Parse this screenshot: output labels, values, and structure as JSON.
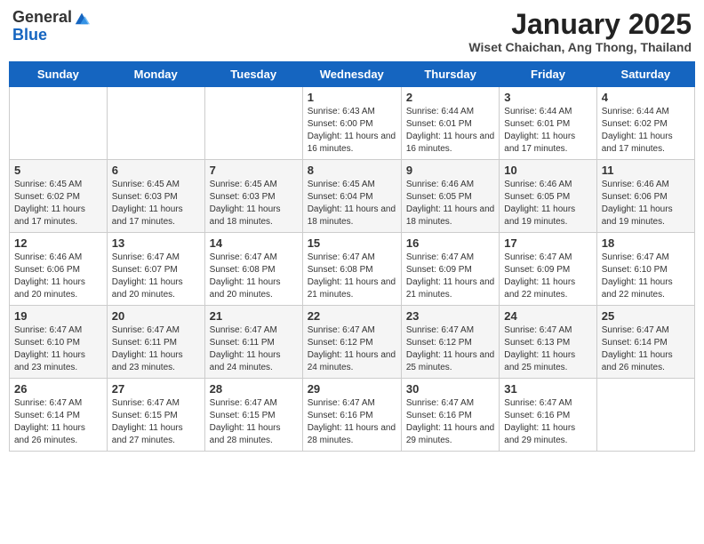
{
  "logo": {
    "general": "General",
    "blue": "Blue"
  },
  "title": "January 2025",
  "subtitle": "Wiset Chaichan, Ang Thong, Thailand",
  "days": [
    "Sunday",
    "Monday",
    "Tuesday",
    "Wednesday",
    "Thursday",
    "Friday",
    "Saturday"
  ],
  "weeks": [
    [
      {
        "day": "",
        "sunrise": "",
        "sunset": "",
        "daylight": ""
      },
      {
        "day": "",
        "sunrise": "",
        "sunset": "",
        "daylight": ""
      },
      {
        "day": "",
        "sunrise": "",
        "sunset": "",
        "daylight": ""
      },
      {
        "day": "1",
        "sunrise": "Sunrise: 6:43 AM",
        "sunset": "Sunset: 6:00 PM",
        "daylight": "Daylight: 11 hours and 16 minutes."
      },
      {
        "day": "2",
        "sunrise": "Sunrise: 6:44 AM",
        "sunset": "Sunset: 6:01 PM",
        "daylight": "Daylight: 11 hours and 16 minutes."
      },
      {
        "day": "3",
        "sunrise": "Sunrise: 6:44 AM",
        "sunset": "Sunset: 6:01 PM",
        "daylight": "Daylight: 11 hours and 17 minutes."
      },
      {
        "day": "4",
        "sunrise": "Sunrise: 6:44 AM",
        "sunset": "Sunset: 6:02 PM",
        "daylight": "Daylight: 11 hours and 17 minutes."
      }
    ],
    [
      {
        "day": "5",
        "sunrise": "Sunrise: 6:45 AM",
        "sunset": "Sunset: 6:02 PM",
        "daylight": "Daylight: 11 hours and 17 minutes."
      },
      {
        "day": "6",
        "sunrise": "Sunrise: 6:45 AM",
        "sunset": "Sunset: 6:03 PM",
        "daylight": "Daylight: 11 hours and 17 minutes."
      },
      {
        "day": "7",
        "sunrise": "Sunrise: 6:45 AM",
        "sunset": "Sunset: 6:03 PM",
        "daylight": "Daylight: 11 hours and 18 minutes."
      },
      {
        "day": "8",
        "sunrise": "Sunrise: 6:45 AM",
        "sunset": "Sunset: 6:04 PM",
        "daylight": "Daylight: 11 hours and 18 minutes."
      },
      {
        "day": "9",
        "sunrise": "Sunrise: 6:46 AM",
        "sunset": "Sunset: 6:05 PM",
        "daylight": "Daylight: 11 hours and 18 minutes."
      },
      {
        "day": "10",
        "sunrise": "Sunrise: 6:46 AM",
        "sunset": "Sunset: 6:05 PM",
        "daylight": "Daylight: 11 hours and 19 minutes."
      },
      {
        "day": "11",
        "sunrise": "Sunrise: 6:46 AM",
        "sunset": "Sunset: 6:06 PM",
        "daylight": "Daylight: 11 hours and 19 minutes."
      }
    ],
    [
      {
        "day": "12",
        "sunrise": "Sunrise: 6:46 AM",
        "sunset": "Sunset: 6:06 PM",
        "daylight": "Daylight: 11 hours and 20 minutes."
      },
      {
        "day": "13",
        "sunrise": "Sunrise: 6:47 AM",
        "sunset": "Sunset: 6:07 PM",
        "daylight": "Daylight: 11 hours and 20 minutes."
      },
      {
        "day": "14",
        "sunrise": "Sunrise: 6:47 AM",
        "sunset": "Sunset: 6:08 PM",
        "daylight": "Daylight: 11 hours and 20 minutes."
      },
      {
        "day": "15",
        "sunrise": "Sunrise: 6:47 AM",
        "sunset": "Sunset: 6:08 PM",
        "daylight": "Daylight: 11 hours and 21 minutes."
      },
      {
        "day": "16",
        "sunrise": "Sunrise: 6:47 AM",
        "sunset": "Sunset: 6:09 PM",
        "daylight": "Daylight: 11 hours and 21 minutes."
      },
      {
        "day": "17",
        "sunrise": "Sunrise: 6:47 AM",
        "sunset": "Sunset: 6:09 PM",
        "daylight": "Daylight: 11 hours and 22 minutes."
      },
      {
        "day": "18",
        "sunrise": "Sunrise: 6:47 AM",
        "sunset": "Sunset: 6:10 PM",
        "daylight": "Daylight: 11 hours and 22 minutes."
      }
    ],
    [
      {
        "day": "19",
        "sunrise": "Sunrise: 6:47 AM",
        "sunset": "Sunset: 6:10 PM",
        "daylight": "Daylight: 11 hours and 23 minutes."
      },
      {
        "day": "20",
        "sunrise": "Sunrise: 6:47 AM",
        "sunset": "Sunset: 6:11 PM",
        "daylight": "Daylight: 11 hours and 23 minutes."
      },
      {
        "day": "21",
        "sunrise": "Sunrise: 6:47 AM",
        "sunset": "Sunset: 6:11 PM",
        "daylight": "Daylight: 11 hours and 24 minutes."
      },
      {
        "day": "22",
        "sunrise": "Sunrise: 6:47 AM",
        "sunset": "Sunset: 6:12 PM",
        "daylight": "Daylight: 11 hours and 24 minutes."
      },
      {
        "day": "23",
        "sunrise": "Sunrise: 6:47 AM",
        "sunset": "Sunset: 6:12 PM",
        "daylight": "Daylight: 11 hours and 25 minutes."
      },
      {
        "day": "24",
        "sunrise": "Sunrise: 6:47 AM",
        "sunset": "Sunset: 6:13 PM",
        "daylight": "Daylight: 11 hours and 25 minutes."
      },
      {
        "day": "25",
        "sunrise": "Sunrise: 6:47 AM",
        "sunset": "Sunset: 6:14 PM",
        "daylight": "Daylight: 11 hours and 26 minutes."
      }
    ],
    [
      {
        "day": "26",
        "sunrise": "Sunrise: 6:47 AM",
        "sunset": "Sunset: 6:14 PM",
        "daylight": "Daylight: 11 hours and 26 minutes."
      },
      {
        "day": "27",
        "sunrise": "Sunrise: 6:47 AM",
        "sunset": "Sunset: 6:15 PM",
        "daylight": "Daylight: 11 hours and 27 minutes."
      },
      {
        "day": "28",
        "sunrise": "Sunrise: 6:47 AM",
        "sunset": "Sunset: 6:15 PM",
        "daylight": "Daylight: 11 hours and 28 minutes."
      },
      {
        "day": "29",
        "sunrise": "Sunrise: 6:47 AM",
        "sunset": "Sunset: 6:16 PM",
        "daylight": "Daylight: 11 hours and 28 minutes."
      },
      {
        "day": "30",
        "sunrise": "Sunrise: 6:47 AM",
        "sunset": "Sunset: 6:16 PM",
        "daylight": "Daylight: 11 hours and 29 minutes."
      },
      {
        "day": "31",
        "sunrise": "Sunrise: 6:47 AM",
        "sunset": "Sunset: 6:16 PM",
        "daylight": "Daylight: 11 hours and 29 minutes."
      },
      {
        "day": "",
        "sunrise": "",
        "sunset": "",
        "daylight": ""
      }
    ]
  ]
}
